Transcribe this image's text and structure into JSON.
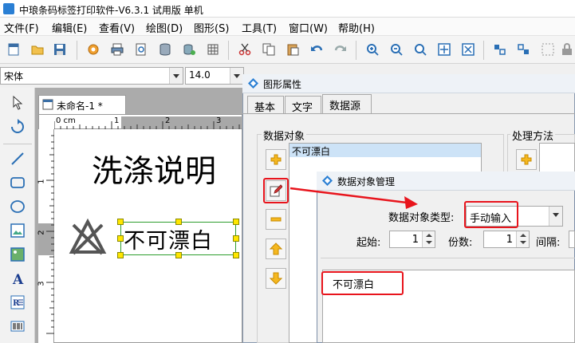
{
  "window": {
    "title": "中琅条码标签打印软件-V6.3.1 试用版 单机"
  },
  "menu": [
    "文件(F)",
    "编辑(E)",
    "查看(V)",
    "绘图(D)",
    "图形(S)",
    "工具(T)",
    "窗口(W)",
    "帮助(H)"
  ],
  "font": {
    "family": "宋体",
    "size": "14.0"
  },
  "document": {
    "tab_label": "未命名-1 *",
    "ruler_units": "0 cm",
    "ruler_h": [
      "1",
      "2",
      "3"
    ],
    "ruler_v": [
      "1",
      "2",
      "3"
    ],
    "title_text": "洗涤说明",
    "bleach_text": "不可漂白"
  },
  "props_dialog": {
    "title": "图形属性",
    "tabs": [
      "基本",
      "文字",
      "数据源"
    ],
    "data_object_label": "数据对象",
    "process_label": "处理方法",
    "list_items": [
      "不可漂白"
    ]
  },
  "data_dialog": {
    "title": "数据对象管理",
    "type_label": "数据对象类型:",
    "type_value": "手动输入",
    "start_label": "起始:",
    "start_value": "1",
    "copies_label": "份数:",
    "copies_value": "1",
    "interval_label": "间隔:",
    "content": "不可漂白"
  },
  "colors": {
    "highlight": "#e8141c",
    "selection": "#cde3f7",
    "handle": "#ffe600"
  }
}
